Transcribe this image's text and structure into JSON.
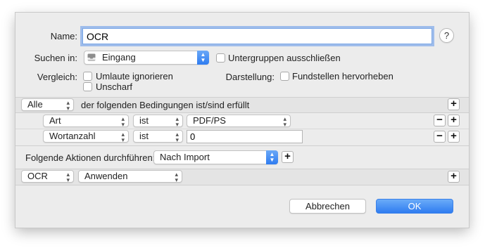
{
  "name": {
    "label": "Name:",
    "value": "OCR"
  },
  "help": {
    "label": "?"
  },
  "search_in": {
    "label": "Suchen in:",
    "value": "Eingang",
    "icon": "inbox-icon"
  },
  "exclude_subgroups": {
    "label": "Untergruppen ausschließen",
    "checked": false
  },
  "compare": {
    "label": "Vergleich:",
    "options": [
      {
        "label": "Umlaute ignorieren",
        "checked": false
      },
      {
        "label": "Unscharf",
        "checked": false
      }
    ]
  },
  "display": {
    "label": "Darstellung:",
    "option": {
      "label": "Fundstellen hervorheben",
      "checked": false
    }
  },
  "conditions": {
    "match": "Alle",
    "match_suffix": "der folgenden Bedingungen ist/sind erfüllt",
    "rows": [
      {
        "field": "Art",
        "operator": "ist",
        "value": "PDF/PS",
        "value_type": "popup"
      },
      {
        "field": "Wortanzahl",
        "operator": "ist",
        "value": "0",
        "value_type": "text"
      }
    ]
  },
  "actions": {
    "label": "Folgende Aktionen durchführen:",
    "trigger": "Nach Import",
    "rows": [
      {
        "action": "OCR",
        "mode": "Anwenden"
      }
    ]
  },
  "buttons": {
    "plus": "+",
    "minus": "−",
    "cancel": "Abbrechen",
    "ok": "OK"
  },
  "colors": {
    "accent": "#2f7cf0",
    "focus_ring": "#6098eb"
  }
}
